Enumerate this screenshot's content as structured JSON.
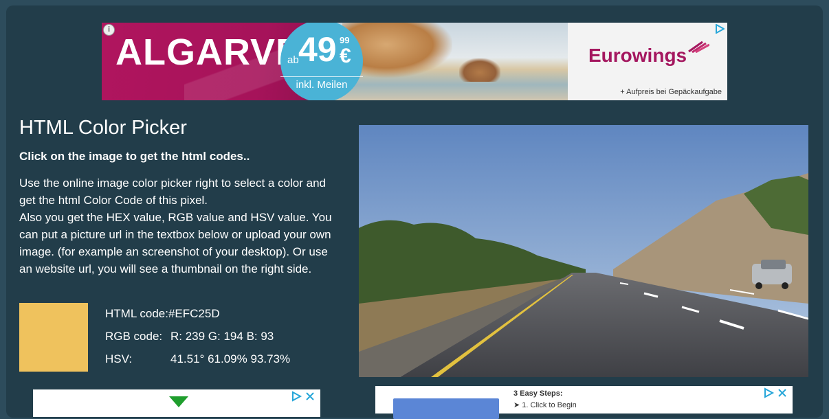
{
  "top_ad": {
    "headline": "ALGARVE",
    "price_prefix": "ab",
    "price_main": "49",
    "price_cents": "99",
    "price_currency": "€",
    "price_note": "inkl. Meilen",
    "brand": "Eurowings",
    "footnote": "+ Aufpreis bei Gepäckaufgabe",
    "info_icon": "i",
    "choices_icon": "ad-choices-icon"
  },
  "picker": {
    "title": "HTML Color Picker",
    "subtitle": "Click on the image to get the html codes..",
    "description": [
      "Use the online image color picker right to select a color and get the html Color Code of this pixel.",
      "Also you get the HEX value, RGB value and HSV value. You can put a picture url in the textbox below or upload your own image. (for example an screenshot of your desktop). Or use an website url, you will see a thumbnail on the right side."
    ],
    "swatch_color": "#efc25d",
    "html_code_label": "HTML code:",
    "html_code_value": "#EFC25D",
    "rgb_label": "RGB code:",
    "rgb_value": "R: 239 G: 194 B: 93",
    "hsv_label": "HSV:",
    "hsv_value": "41.51° 61.09% 93.73%"
  },
  "main_image": {
    "subject": "highway road photo"
  },
  "bottom_ads": {
    "right_steps_title": "3 Easy Steps:",
    "right_step_1": "1. Click to Begin",
    "close_glyph": "▷ ✕"
  },
  "colors": {
    "page_bg": "#2d4c5c",
    "panel_bg": "#223d4a",
    "brand_magenta": "#a4175f",
    "price_blue": "#4ab3d6"
  }
}
